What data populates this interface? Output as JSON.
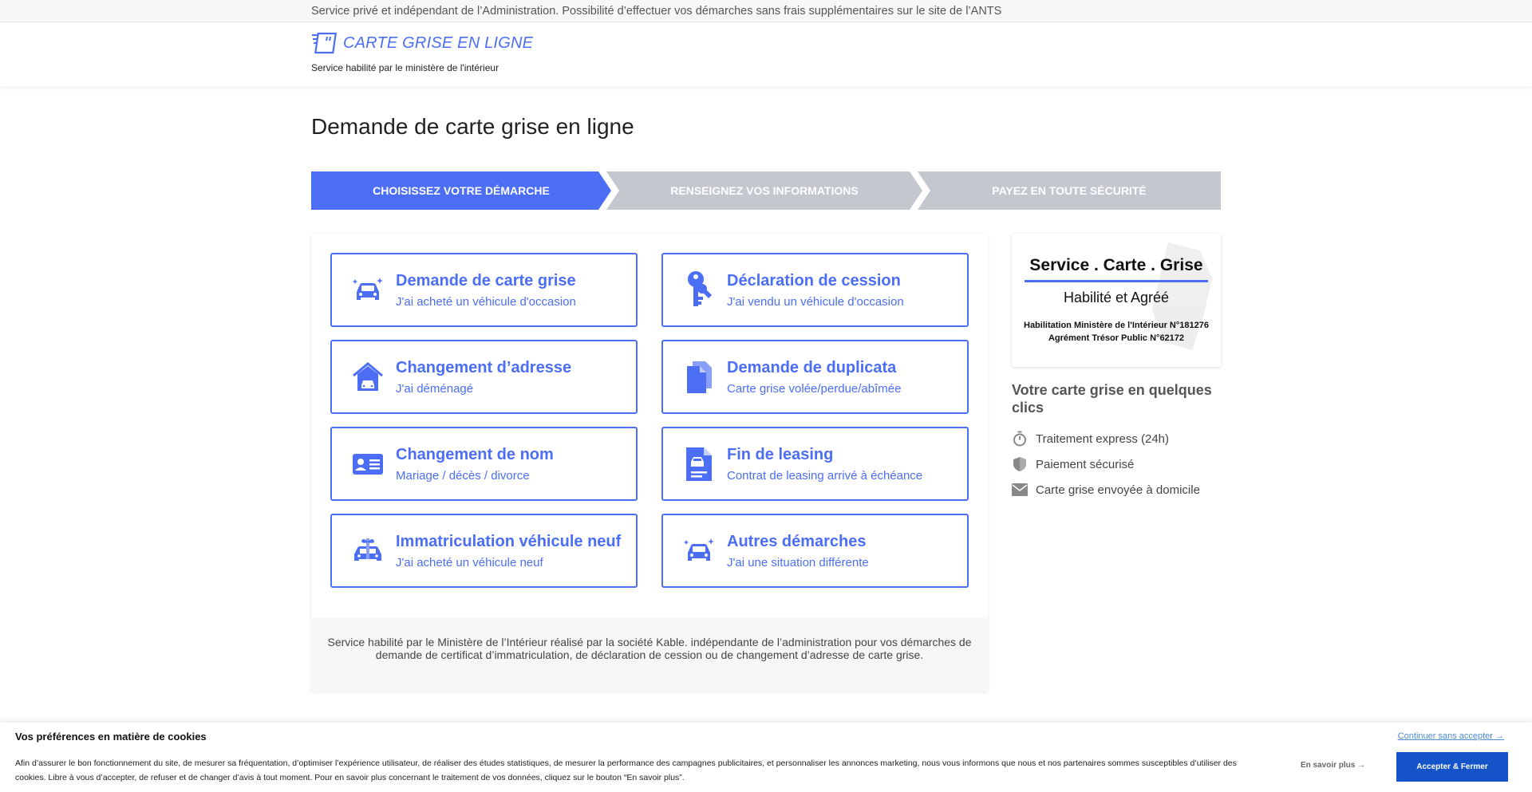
{
  "topbar": {
    "text": "Service privé et indépendant de l’Administration. Possibilité d’effectuer vos démarches sans frais supplémentaires sur le site de l’ANTS"
  },
  "header": {
    "logo_text": "CARTE GRISE EN LIGNE",
    "logo_subtitle": "Service habilité par le ministère de l'intérieur"
  },
  "page_title": "Demande de carte grise en ligne",
  "steps": [
    {
      "label": "CHOISISSEZ VOTRE DÉMARCHE",
      "active": true
    },
    {
      "label": "RENSEIGNEZ VOS INFORMATIONS",
      "active": false
    },
    {
      "label": "PAYEZ EN TOUTE SÉCURITÉ",
      "active": false
    }
  ],
  "tiles": [
    {
      "title": "Demande de carte grise",
      "subtitle": "J'ai acheté un véhicule d'occasion",
      "icon": "car-sparkle-icon"
    },
    {
      "title": "Déclaration de cession",
      "subtitle": "J'ai vendu un véhicule d'occasion",
      "icon": "keys-icon"
    },
    {
      "title": "Changement d’adresse",
      "subtitle": "J'ai déménagé",
      "icon": "house-car-icon"
    },
    {
      "title": "Demande de duplicata",
      "subtitle": "Carte grise volée/perdue/abîmée",
      "icon": "documents-icon"
    },
    {
      "title": "Changement de nom",
      "subtitle": "Mariage / décès / divorce",
      "icon": "id-card-icon"
    },
    {
      "title": "Fin de leasing",
      "subtitle": "Contrat de leasing arrivé à échéance",
      "icon": "car-document-icon"
    },
    {
      "title": "Immatriculation véhicule neuf",
      "subtitle": "J'ai acheté un véhicule neuf",
      "icon": "gift-car-icon"
    },
    {
      "title": "Autres démarches",
      "subtitle": "J'ai une situation différente",
      "icon": "car-sparkle-icon"
    }
  ],
  "footer_note": "Service habilité par le Ministère de l’Intérieur réalisé par la société Kable. indépendante de l’administration pour vos démarches de demande de certificat d’immatriculation, de déclaration de cession ou de changement d’adresse de carte grise.",
  "side_card": {
    "title": "Service . Carte . Grise",
    "subtitle": "Habilité et Agréé",
    "line1": "Habilitation Ministère de l'Intérieur N°181276",
    "line2": "Agrément Trésor Public N°62172"
  },
  "side": {
    "heading": "Votre carte grise en quelques clics",
    "features": [
      {
        "label": "Traitement express (24h)",
        "icon": "stopwatch-icon"
      },
      {
        "label": "Paiement sécurisé",
        "icon": "shield-icon"
      },
      {
        "label": "Carte grise envoyée à domicile",
        "icon": "envelope-icon"
      }
    ]
  },
  "cookie": {
    "title": "Vos préférences en matière de cookies",
    "text": "Afin d’assurer le bon fonctionnement du site, de mesurer sa fréquentation, d’optimiser l’expérience utilisateur, de réaliser des études statistiques, de mesurer la performance des campagnes publicitaires, et personnaliser les annonces marketing, nous vous informons que nous et nos partenaires sommes susceptibles d’utiliser des cookies. Libre à vous d’accepter, de refuser et de changer d’avis à tout moment. Pour en savoir plus concernant le traitement de vos données, cliquez sur le bouton “En savoir plus”.",
    "continue_label": "Continuer sans accepter →",
    "more_label": "En savoir plus →",
    "accept_label": "Accepter & Fermer"
  },
  "colors": {
    "accent": "#4b6ef5",
    "step_inactive": "#c4c8ce",
    "accept": "#1553c9"
  }
}
